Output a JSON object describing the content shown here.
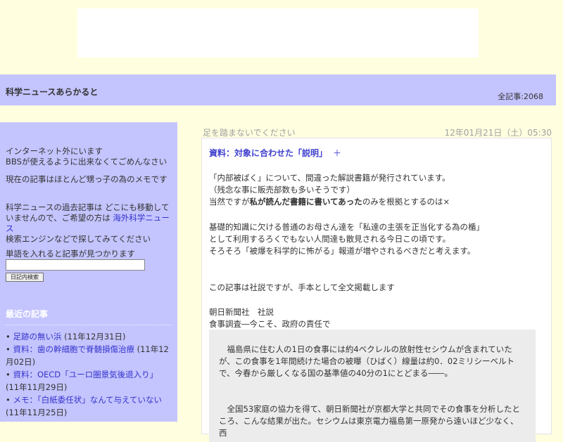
{
  "header": {
    "site_title": "科学ニュースあらかると",
    "total_articles": "全記事:2068"
  },
  "sidebar": {
    "notice_line1": "インターネット外にいます",
    "notice_line2": "BBSが使えるように出来なくてごめんなさい",
    "memo": "現在の記事はほとんど甥っ子の為のメモです",
    "past_text_before": "科学ニュースの過去記事は どこにも移動していませんので、ご希望の方は ",
    "past_link": "海外科学ニュース",
    "past_text_after": "検索エンジンなどで探してみてください",
    "search_label": "単語を入れると記事が見つかります",
    "search_value": "",
    "search_button": "日記内検索",
    "recent_title": "最近の記事",
    "recent_items": [
      {
        "title": "足跡の無い浜",
        "date": " (11年12月31日)"
      },
      {
        "title": "資料：歯の幹細胞で脊髄損傷治療",
        "date": " (11年12月02日)"
      },
      {
        "title": "資料：OECD「ユーロ圏景気後退入り」",
        "date": " (11年11月29日)"
      },
      {
        "title": "メモ：「白紙委任状」なんて与えていない",
        "date": " (11年11月25日)"
      }
    ]
  },
  "main": {
    "subheading": "足を踏まないでください",
    "date": "12年01月21日（土）05:30",
    "article_title": "資料：対象に合わせた「説明」",
    "plus": "＋",
    "para1": [
      "「内部被ばく」について、間違った解説書籍が発行されています。",
      "（残念な事に販売部数も多いそうです）"
    ],
    "para1_line3_before": "当然ですが",
    "para1_line3_bold": "私が読んだ書籍に書いてあった",
    "para1_line3_after": "のみを根拠とするのは×",
    "para2": [
      "基礎的知識に欠ける普通のお母さん達を「私達の主張を正当化する為の楯」",
      "として利用するろくでもない人間達も散見される今日この頃です。",
      "そろそろ「被爆を科学的に怖がる」報道が増やされるべきだと考えます。"
    ],
    "para3": "この記事は社説ですが、手本として全文掲載します",
    "para4": [
      "朝日新聞社　社説",
      "食事調査―今こそ、政府の責任で"
    ],
    "quote1": "　福島県に住む人の1日の食事には約4ベクレルの放射性セシウムが含まれていたが、この食事を1年間続けた場合の被曝（ひばく）線量は約0．02ミリシーベルトで、今春から厳しくなる国の基準値の40分の1にとどまる――。",
    "quote2": "　全国53家庭の協力を得て、朝日新聞社が京都大学と共同でその食事を分析したところ、こんな結果が出た。セシウムは東京電力福島第一原発から遠いほど少なく、西"
  }
}
